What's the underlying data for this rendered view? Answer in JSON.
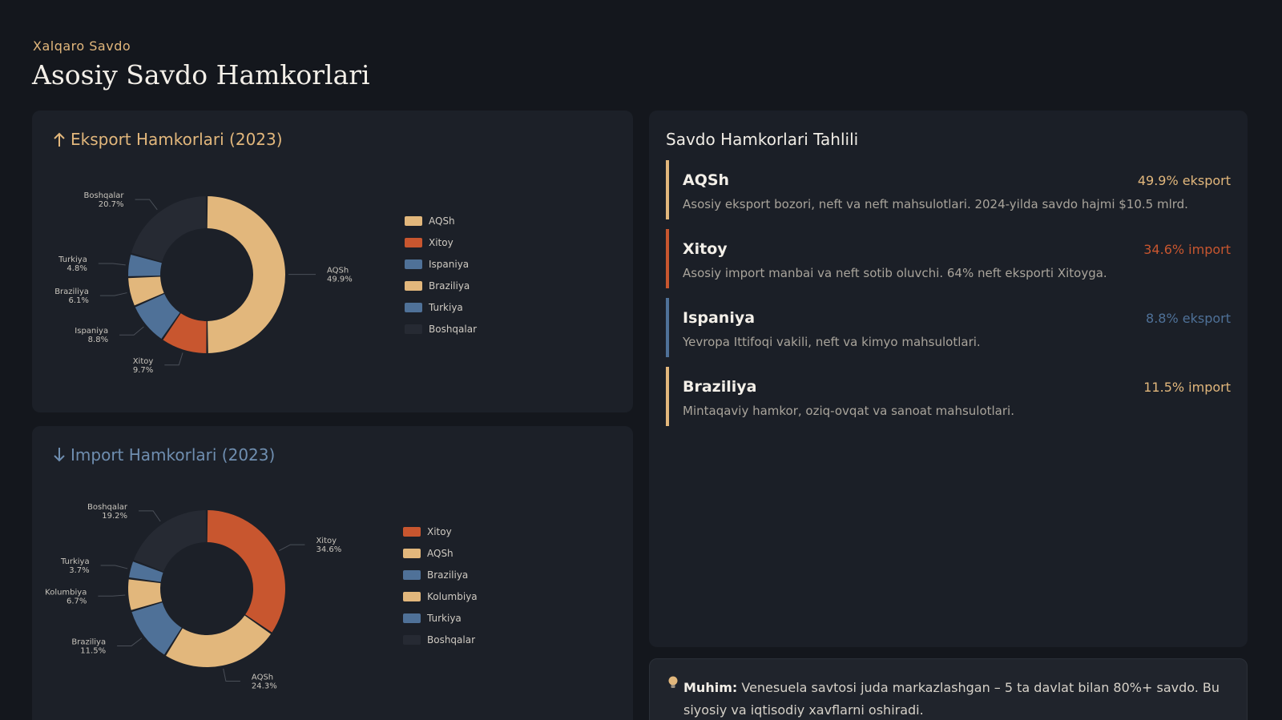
{
  "header": {
    "eyebrow": "Xalqaro Savdo",
    "title": "Asosiy Savdo Hamkorlari"
  },
  "colors": {
    "gold": "#e2b77c",
    "red": "#c8562f",
    "blue": "#4f7198",
    "dark": "#262a33",
    "import_blue": "#6f8eb0"
  },
  "export_card": {
    "heading": "Eksport Hamkorlari (2023)",
    "icon": "arrow-up-icon"
  },
  "import_card": {
    "heading": "Import Hamkorlari (2023)",
    "icon": "arrow-down-icon"
  },
  "chart_data": [
    {
      "type": "pie",
      "title": "Eksport Hamkorlari (2023)",
      "donut": true,
      "legend": "right",
      "slices": [
        {
          "label": "AQSh",
          "value": 49.9,
          "display": "49.9%",
          "color": "#e2b77c"
        },
        {
          "label": "Xitoy",
          "value": 9.7,
          "display": "9.7%",
          "color": "#c8562f"
        },
        {
          "label": "Ispaniya",
          "value": 8.8,
          "display": "8.8%",
          "color": "#4f7198"
        },
        {
          "label": "Braziliya",
          "value": 6.1,
          "display": "6.1%",
          "color": "#e2b77c"
        },
        {
          "label": "Turkiya",
          "value": 4.8,
          "display": "4.8%",
          "color": "#4f7198"
        },
        {
          "label": "Boshqalar",
          "value": 20.7,
          "display": "20.7%",
          "color": "#262a33"
        }
      ]
    },
    {
      "type": "pie",
      "title": "Import Hamkorlari (2023)",
      "donut": true,
      "legend": "right",
      "slices": [
        {
          "label": "Xitoy",
          "value": 34.6,
          "display": "34.6%",
          "color": "#c8562f"
        },
        {
          "label": "AQSh",
          "value": 24.3,
          "display": "24.3%",
          "color": "#e2b77c"
        },
        {
          "label": "Braziliya",
          "value": 11.5,
          "display": "11.5%",
          "color": "#4f7198"
        },
        {
          "label": "Kolumbiya",
          "value": 6.7,
          "display": "6.7%",
          "color": "#e2b77c"
        },
        {
          "label": "Turkiya",
          "value": 3.7,
          "display": "3.7%",
          "color": "#4f7198"
        },
        {
          "label": "Boshqalar",
          "value": 19.2,
          "display": "19.2%",
          "color": "#262a33"
        }
      ]
    }
  ],
  "analysis": {
    "title": "Savdo Hamkorlari Tahlili",
    "partners": [
      {
        "name": "AQSh",
        "share": "49.9% eksport",
        "desc": "Asosiy eksport bozori, neft va neft mahsulotlari. 2024-yilda savdo hajmi $10.5 mlrd.",
        "color": "#e2b77c"
      },
      {
        "name": "Xitoy",
        "share": "34.6% import",
        "desc": "Asosiy import manbai va neft sotib oluvchi. 64% neft eksporti Xitoyga.",
        "color": "#c8562f"
      },
      {
        "name": "Ispaniya",
        "share": "8.8% eksport",
        "desc": "Yevropa Ittifoqi vakili, neft va kimyo mahsulotlari.",
        "color": "#4f7198"
      },
      {
        "name": "Braziliya",
        "share": "11.5% import",
        "desc": "Mintaqaviy hamkor, oziq-ovqat va sanoat mahsulotlari.",
        "color": "#e2b77c"
      }
    ]
  },
  "note": {
    "icon": "lightbulb-icon",
    "label": "Muhim:",
    "text": "Venesuela savtosi juda markazlashgan – 5 ta davlat bilan 80%+ savdo. Bu siyosiy va iqtisodiy xavflarni oshiradi."
  }
}
